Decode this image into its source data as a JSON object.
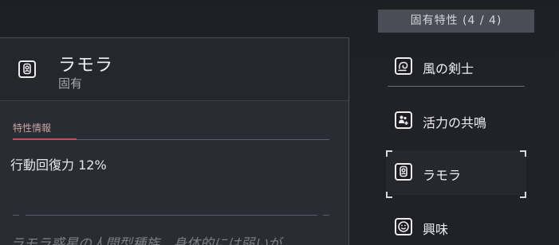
{
  "detail": {
    "title": "ラモラ",
    "subtitle": "固有",
    "icon": "ramora-badge-icon",
    "section_label": "特性情報",
    "effect": "行動回復力 12%",
    "flavor": "ラモラ惑星の人間型種族。身体的には弱いが"
  },
  "trait_list": {
    "header": "固有特性 (4 / 4)",
    "items": [
      {
        "label": "風の剣士",
        "icon": "wind-swirl-icon",
        "selected": false
      },
      {
        "label": "活力の共鳴",
        "icon": "people-plus-icon",
        "selected": false
      },
      {
        "label": "ラモラ",
        "icon": "ramora-badge-icon",
        "selected": true
      },
      {
        "label": "興味",
        "icon": "smiley-icon",
        "selected": false
      }
    ]
  },
  "colors": {
    "accent_red": "#c0505a",
    "panel": "#2a2c33",
    "header_bar": "#4a4d56"
  }
}
